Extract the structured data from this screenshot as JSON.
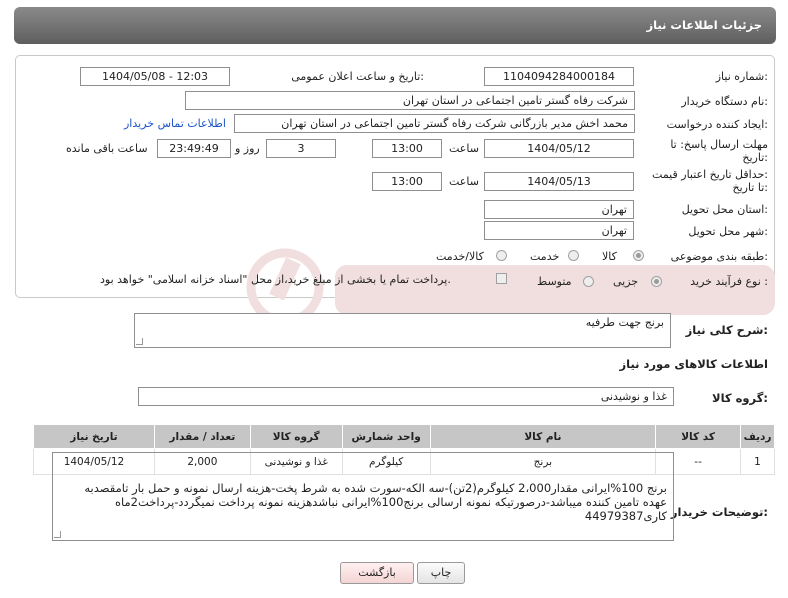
{
  "header": {
    "title": "جزئیات اطلاعات نیاز"
  },
  "form": {
    "need_number": {
      "label": "شماره نیاز:",
      "value": "1104094284000184"
    },
    "announce": {
      "label": "تاریخ و ساعت اعلان عمومی:",
      "value": "1404/05/08 - 12:03"
    },
    "buyer_org": {
      "label": "نام دستگاه خریدار:",
      "value": "شرکت رفاه گستر تامین اجتماعی در استان تهران"
    },
    "creator": {
      "label": "ایجاد کننده درخواست:",
      "value": "محمد اخش مدیر بازرگانی شرکت رفاه گستر تامین اجتماعی در استان تهران",
      "contact_link": "اطلاعات تماس خریدار"
    },
    "deadline": {
      "label1": "مهلت ارسال پاسخ: تا",
      "label2": "تاریخ:",
      "date": "1404/05/12",
      "time_label": "ساعت",
      "time": "13:00",
      "days": "3",
      "days_label": "روز و",
      "remaining": "23:49:49",
      "remaining_label": "ساعت باقی مانده"
    },
    "price_validity": {
      "label1": "حداقل تاریخ اعتبار قیمت:",
      "label2": "تا تاریخ:",
      "date": "1404/05/13",
      "time_label": "ساعت",
      "time": "13:00"
    },
    "delivery_province": {
      "label": "استان محل تحویل:",
      "value": "تهران"
    },
    "delivery_city": {
      "label": "شهر محل تحویل:",
      "value": "تهران"
    },
    "category": {
      "label": "طبقه بندی موضوعی:",
      "options": [
        "کالا",
        "خدمت",
        "کالا/خدمت"
      ],
      "selected": "کالا"
    },
    "purchase_type": {
      "label": "نوع فرآیند خرید :",
      "options": [
        "جزیی",
        "متوسط"
      ],
      "selected": "جزیی",
      "payment_note": "پرداخت تمام یا بخشی از مبلغ خرید،از محل \"اسناد خزانه اسلامی\" خواهد بود."
    }
  },
  "summary": {
    "label": "شرح کلی نیاز:",
    "value": "برنج جهت طرفیه"
  },
  "items_section": {
    "title": "اطلاعات کالاهای مورد نیاز",
    "group_label": "گروه کالا:",
    "group_value": "غذا و نوشیدنی",
    "columns": [
      "ردیف",
      "کد کالا",
      "نام کالا",
      "واحد شمارش",
      "گروه کالا",
      "تعداد / مقدار",
      "تاریخ نیاز"
    ],
    "rows": [
      [
        "1",
        "--",
        "برنج",
        "کیلوگرم",
        "غذا و نوشیدنی",
        "2,000",
        "1404/05/12"
      ]
    ]
  },
  "buyer_notes": {
    "label": "توضیحات خریدار:",
    "lines": [
      "برنج 100%ایرانی مقدار2،000 کیلوگرم(2تن)-سه الکه-سورت شده به شرط پخت-هزینه ارسال نمونه و حمل بار تامقصدبه",
      "عهده تامین کننده میباشد-درصورتیکه نمونه ارسالی برنج100%ایرانی نباشدهزینه نمونه پرداخت نمیگردد-پرداخت2ماه",
      "کاری44979387"
    ]
  },
  "buttons": {
    "print": "چاپ",
    "back": "بازگشت"
  },
  "colors": {
    "header_bg": "#6e6e6e",
    "link": "#1a54c8",
    "table_header": "#c6c6c6",
    "back_button": "#f4d4d4"
  }
}
